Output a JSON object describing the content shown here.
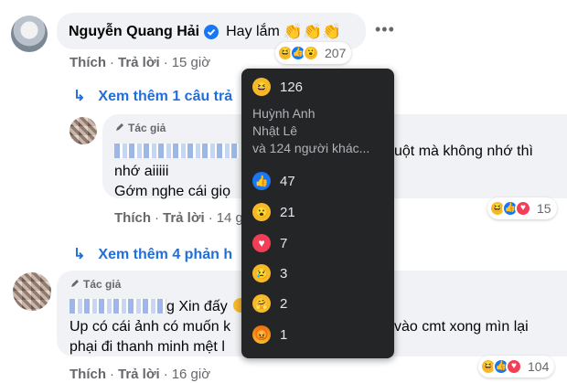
{
  "comment1": {
    "author": "Nguyễn Quang Hải",
    "verified_icon": "verified-badge-icon",
    "text": "Hay lắm",
    "emoji": "👏👏👏",
    "reaction_count": "207",
    "actions": {
      "like": "Thích",
      "reply": "Trả lời",
      "time": "15 giờ"
    },
    "more_icon": "ellipsis-icon"
  },
  "view_more_1": "Xem thêm 1 câu trả",
  "reply1": {
    "author_tag": "Tác giả",
    "line1_suffix": "uột mà không nhớ thì",
    "line2": "nhớ aiiiii",
    "line3": "Gớm nghe cái giọ",
    "reaction_count": "15",
    "actions": {
      "like": "Thích",
      "reply": "Trả lời",
      "time": "14 g"
    }
  },
  "view_more_2": "Xem thêm 4 phản h",
  "reply2": {
    "author_tag": "Tác giả",
    "line1_suffix": "g Xin đấy",
    "line2_prefix": "Up có cái ảnh có muốn k",
    "line2_suffix": "vào cmt xong mìn lại",
    "line3": "phại đi thanh minh mệt l",
    "reaction_count": "104",
    "actions": {
      "like": "Thích",
      "reply": "Trả lời",
      "time": "16 giờ"
    }
  },
  "tooltip": {
    "haha_count": "126",
    "names": [
      "Huỳnh Anh",
      "Nhật Lê",
      "và 124 người khác..."
    ],
    "like_count": "47",
    "wow_count": "21",
    "love_count": "7",
    "sad_count": "3",
    "care_count": "2",
    "angry_count": "1"
  },
  "colors": {
    "link": "#216fdb",
    "bubble": "#f0f2f5",
    "tooltip_bg": "#242526",
    "like": "#1877f2",
    "love": "#f33e58",
    "haha": "#f7b928"
  }
}
